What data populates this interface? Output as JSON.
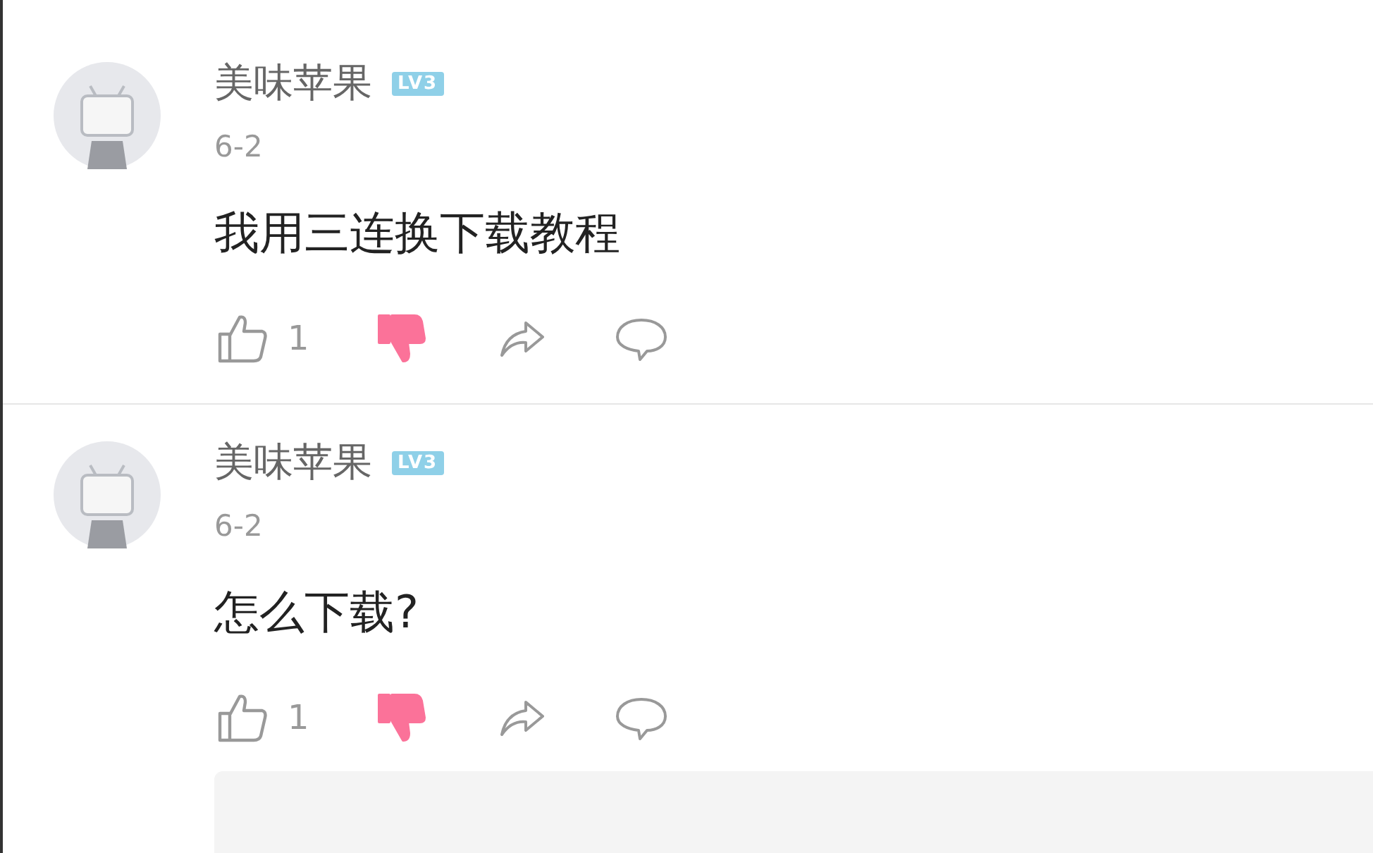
{
  "comments": [
    {
      "user": "美味苹果",
      "level_badge": "LV3",
      "date": "6-2",
      "text": "我用三连换下载教程",
      "like_count": "1",
      "liked": false,
      "disliked": true
    },
    {
      "user": "美味苹果",
      "level_badge": "LV3",
      "date": "6-2",
      "text": "怎么下载?",
      "like_count": "1",
      "liked": false,
      "disliked": true
    }
  ],
  "reply_box": {
    "kind": "collapsed"
  }
}
